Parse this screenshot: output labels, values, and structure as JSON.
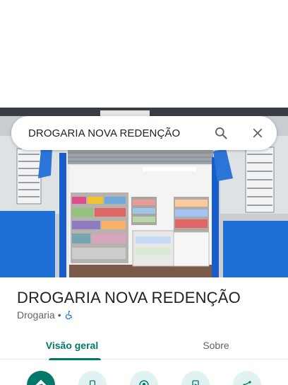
{
  "search": {
    "query": "DROGARIA NOVA REDENÇÃO"
  },
  "place": {
    "name": "DROGARIA NOVA REDENÇÃO",
    "category": "Drogaria",
    "separator": "•",
    "accessibility_icon": "wheelchair-icon"
  },
  "tabs": [
    {
      "label": "Visão geral",
      "active": true
    },
    {
      "label": "Sobre",
      "active": false
    }
  ],
  "actions": [
    {
      "icon": "directions-icon"
    },
    {
      "icon": "phone-icon"
    },
    {
      "icon": "nearby-icon"
    },
    {
      "icon": "send-to-phone-icon"
    },
    {
      "icon": "share-icon"
    }
  ],
  "colors": {
    "accent": "#00796b",
    "accent_light": "#e0f2f1"
  }
}
